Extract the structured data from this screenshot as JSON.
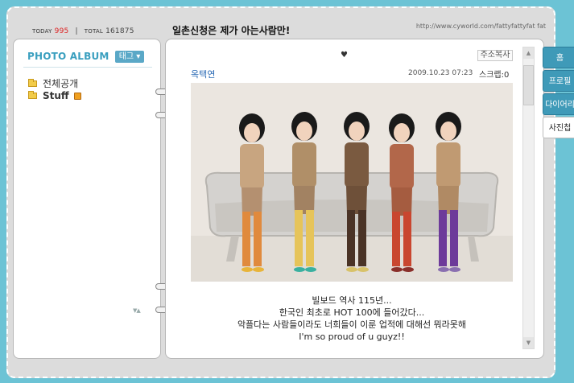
{
  "counter": {
    "today_label": "TODAY",
    "today_value": "995",
    "separator": "|",
    "total_label": "TOTAL",
    "total_value": "161875"
  },
  "header": {
    "title": "일촌신청은 제가 아는사람만!",
    "url": "http://www.cyworld.com/fattyfattyfat fat"
  },
  "sidebar": {
    "title": "PHOTO ALBUM",
    "tag_button": "태그 ▾",
    "folders": [
      {
        "label": "전체공개",
        "bold": false
      },
      {
        "label": "Stuff",
        "bold": true
      }
    ]
  },
  "post": {
    "heart": "♥",
    "address_copy": "주소복사",
    "author": "옥택연",
    "date": "2009.10.23 07:23",
    "scrap": "스크랩:0",
    "caption_lines": [
      "빌보드 역사 115년...",
      "한국인 최초로 HOT 100에 들어갔다...",
      "악플다는 사람들이라도 너희들이 이룬 업적에 대해선 뭐라못해",
      "I'm so proud of u guyz!!"
    ]
  },
  "tabs": [
    {
      "label": "홈"
    },
    {
      "label": "프로필"
    },
    {
      "label": "다이어리"
    },
    {
      "label": "사진첩"
    }
  ],
  "colors": {
    "background": "#6cc3d5",
    "accent": "#3a9fbf",
    "tab": "#3f9ab8",
    "today": "#dd2222"
  }
}
